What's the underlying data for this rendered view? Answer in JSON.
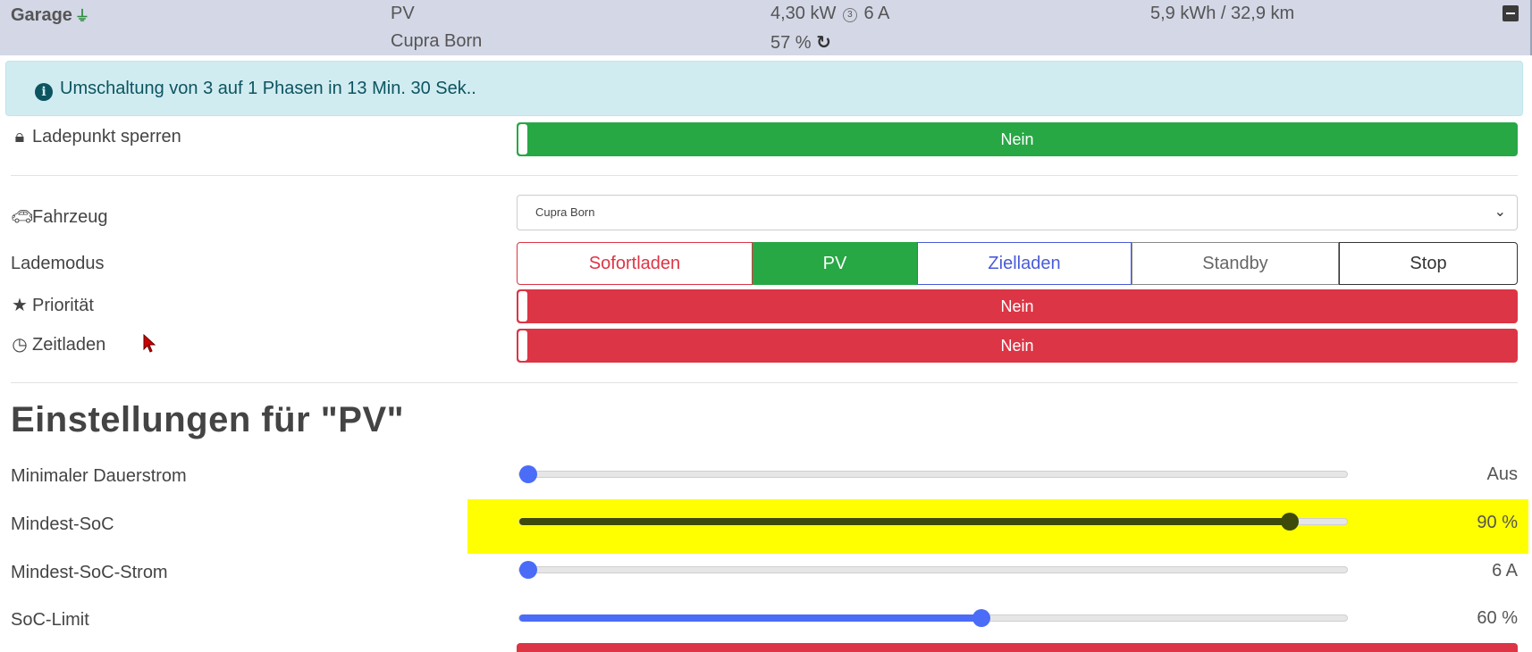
{
  "header": {
    "garage": "Garage",
    "mode": "PV",
    "vehicle": "Cupra Born",
    "power": "4,30 kW",
    "current": "6 A",
    "soc": "57 %",
    "energy": "5,9 kWh / 32,9 km"
  },
  "alert": {
    "text": "Umschaltung von 3 auf 1 Phasen in 13 Min. 30 Sek.."
  },
  "rows": {
    "lock": {
      "label": "Ladepunkt sperren",
      "value": "Nein"
    },
    "vehicle": {
      "label": "Fahrzeug",
      "selected": "Cupra Born"
    },
    "mode": {
      "label": "Lademodus",
      "options": [
        "Sofortladen",
        "PV",
        "Zielladen",
        "Standby",
        "Stop"
      ],
      "active": "PV"
    },
    "priority": {
      "label": "Priorität",
      "value": "Nein"
    },
    "timed": {
      "label": "Zeitladen",
      "value": "Nein"
    }
  },
  "settings": {
    "title": "Einstellungen für \"PV\"",
    "sliders": [
      {
        "label": "Minimaler Dauerstrom",
        "value": "Aus",
        "fraction": 0.0
      },
      {
        "label": "Mindest-SoC",
        "value": "90 %",
        "fraction": 0.94
      },
      {
        "label": "Mindest-SoC-Strom",
        "value": "6 A",
        "fraction": 0.0
      },
      {
        "label": "SoC-Limit",
        "value": "60 %",
        "fraction": 0.56
      }
    ]
  },
  "colors": {
    "green": "#28a745",
    "red": "#dc3545",
    "blue": "#4a5bd8",
    "highlight": "#ffff00"
  }
}
